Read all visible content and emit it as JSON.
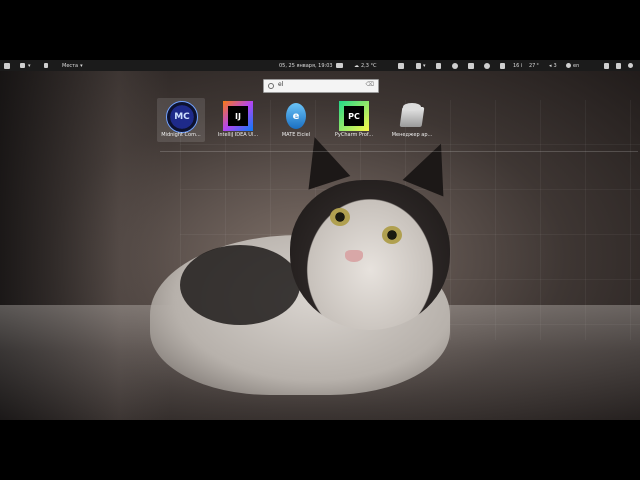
{
  "panel": {
    "places_label": "Места",
    "datetime": "05, 25 января, 19:03",
    "weather": "2,3 °C",
    "cpu_text": "16",
    "temp_text": "27",
    "volume_text": "3",
    "lang": "en"
  },
  "search": {
    "value": "el",
    "placeholder": ""
  },
  "apps": [
    {
      "label": "Midnight Com...",
      "icon": "midnight-commander-icon",
      "icon_text": "MC"
    },
    {
      "label": "IntelliJ IDEA Ul...",
      "icon": "intellij-idea-icon",
      "icon_text": "IJ"
    },
    {
      "label": "MATE Eiciel",
      "icon": "mate-eiciel-icon",
      "icon_text": "e"
    },
    {
      "label": "PyCharm Prof...",
      "icon": "pycharm-icon",
      "icon_text": "PC"
    },
    {
      "label": "Менеджер ар...",
      "icon": "archive-manager-icon",
      "icon_text": ""
    }
  ]
}
